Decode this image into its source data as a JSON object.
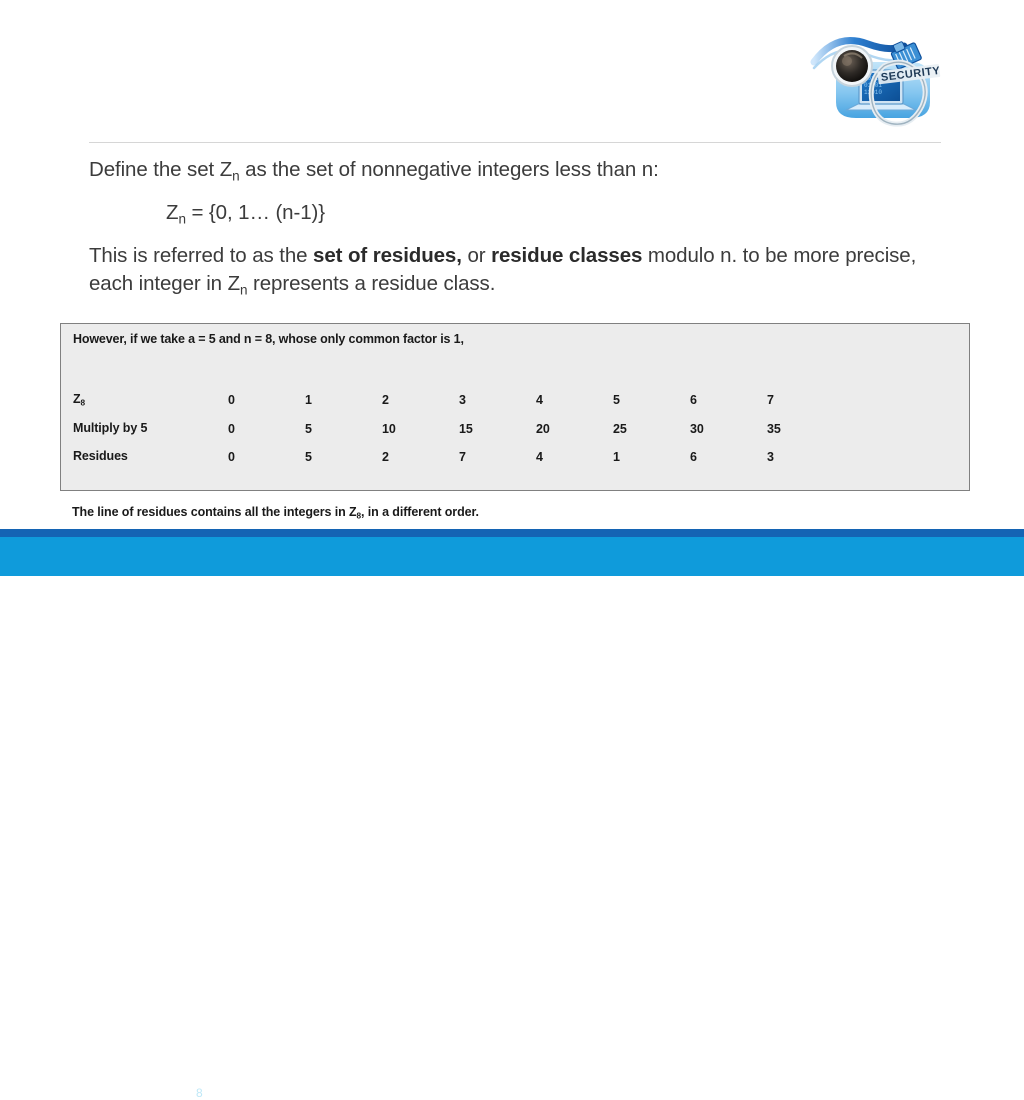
{
  "slide": {
    "number": "8",
    "logo_alt": "network-security-logo",
    "logo_text": "SECURITY"
  },
  "colors": {
    "footer_top_bar": "#1464b4",
    "footer_main_bar": "#0f9bdb",
    "slide_number_text": "#bfe8f7",
    "panel_background": "#ececec",
    "panel_border": "#808080",
    "body_text": "#3c3c3c",
    "divider": "#d6d6d6"
  },
  "content": {
    "para_define_pre": "Define the set Z",
    "para_define_sub": "n",
    "para_define_post": " as the set of nonnegative integers less than n:",
    "set_definition_pre": "Z",
    "set_definition_sub": "n",
    "set_definition_post": " = {0, 1… (n-1)}",
    "para_residues_p1": "This is referred to as the ",
    "para_residues_b1": "set of residues,",
    "para_residues_p2": " or ",
    "para_residues_b2": "residue classes",
    "para_residues_p3": " modulo n. to be more precise, each integer in Z",
    "para_residues_sub": "n",
    "para_residues_p4": " represents a residue class."
  },
  "table": {
    "intro": "However, if we take a = 5 and n = 8, whose only common factor is 1,",
    "caption_pre": "The line of residues contains all the integers in Z",
    "caption_sub": "8",
    "caption_post": ", in a different order.",
    "rows": [
      {
        "label_pre": "Z",
        "label_sub": "8",
        "label_post": "",
        "values": [
          "0",
          "1",
          "2",
          "3",
          "4",
          "5",
          "6",
          "7"
        ]
      },
      {
        "label_pre": "Multiply by 5",
        "label_sub": "",
        "label_post": "",
        "values": [
          "0",
          "5",
          "10",
          "15",
          "20",
          "25",
          "30",
          "35"
        ]
      },
      {
        "label_pre": "Residues",
        "label_sub": "",
        "label_post": "",
        "values": [
          "0",
          "5",
          "2",
          "7",
          "4",
          "1",
          "6",
          "3"
        ]
      }
    ]
  }
}
